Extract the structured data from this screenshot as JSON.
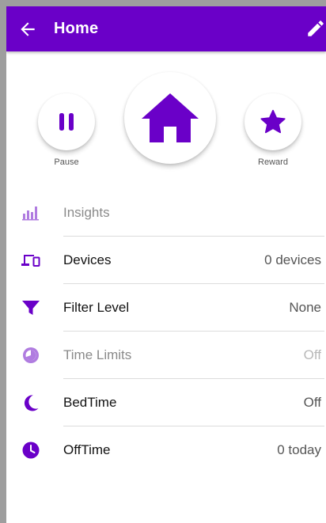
{
  "appbar": {
    "title": "Home",
    "back_icon": "arrow-left-icon",
    "edit_icon": "pencil-icon",
    "color": "#6a00c8"
  },
  "actions": {
    "pause_label": "Pause",
    "home_icon": "house-icon",
    "reward_label": "Reward"
  },
  "colors": {
    "accent": "#6a00c8",
    "accent_light": "#b07ce0",
    "text": "#111111",
    "muted": "#8a8a8a"
  },
  "menu": [
    {
      "label": "Insights",
      "value": "",
      "icon": "bar-chart-icon",
      "enabled": false
    },
    {
      "label": "Devices",
      "value": "0 devices",
      "icon": "devices-icon",
      "enabled": true
    },
    {
      "label": "Filter Level",
      "value": "None",
      "icon": "filter-icon",
      "enabled": true
    },
    {
      "label": "Time Limits",
      "value": "Off",
      "icon": "timer-icon",
      "enabled": false
    },
    {
      "label": "BedTime",
      "value": "Off",
      "icon": "moon-icon",
      "enabled": true
    },
    {
      "label": "OffTime",
      "value": "0 today",
      "icon": "clock-icon",
      "enabled": true
    }
  ]
}
